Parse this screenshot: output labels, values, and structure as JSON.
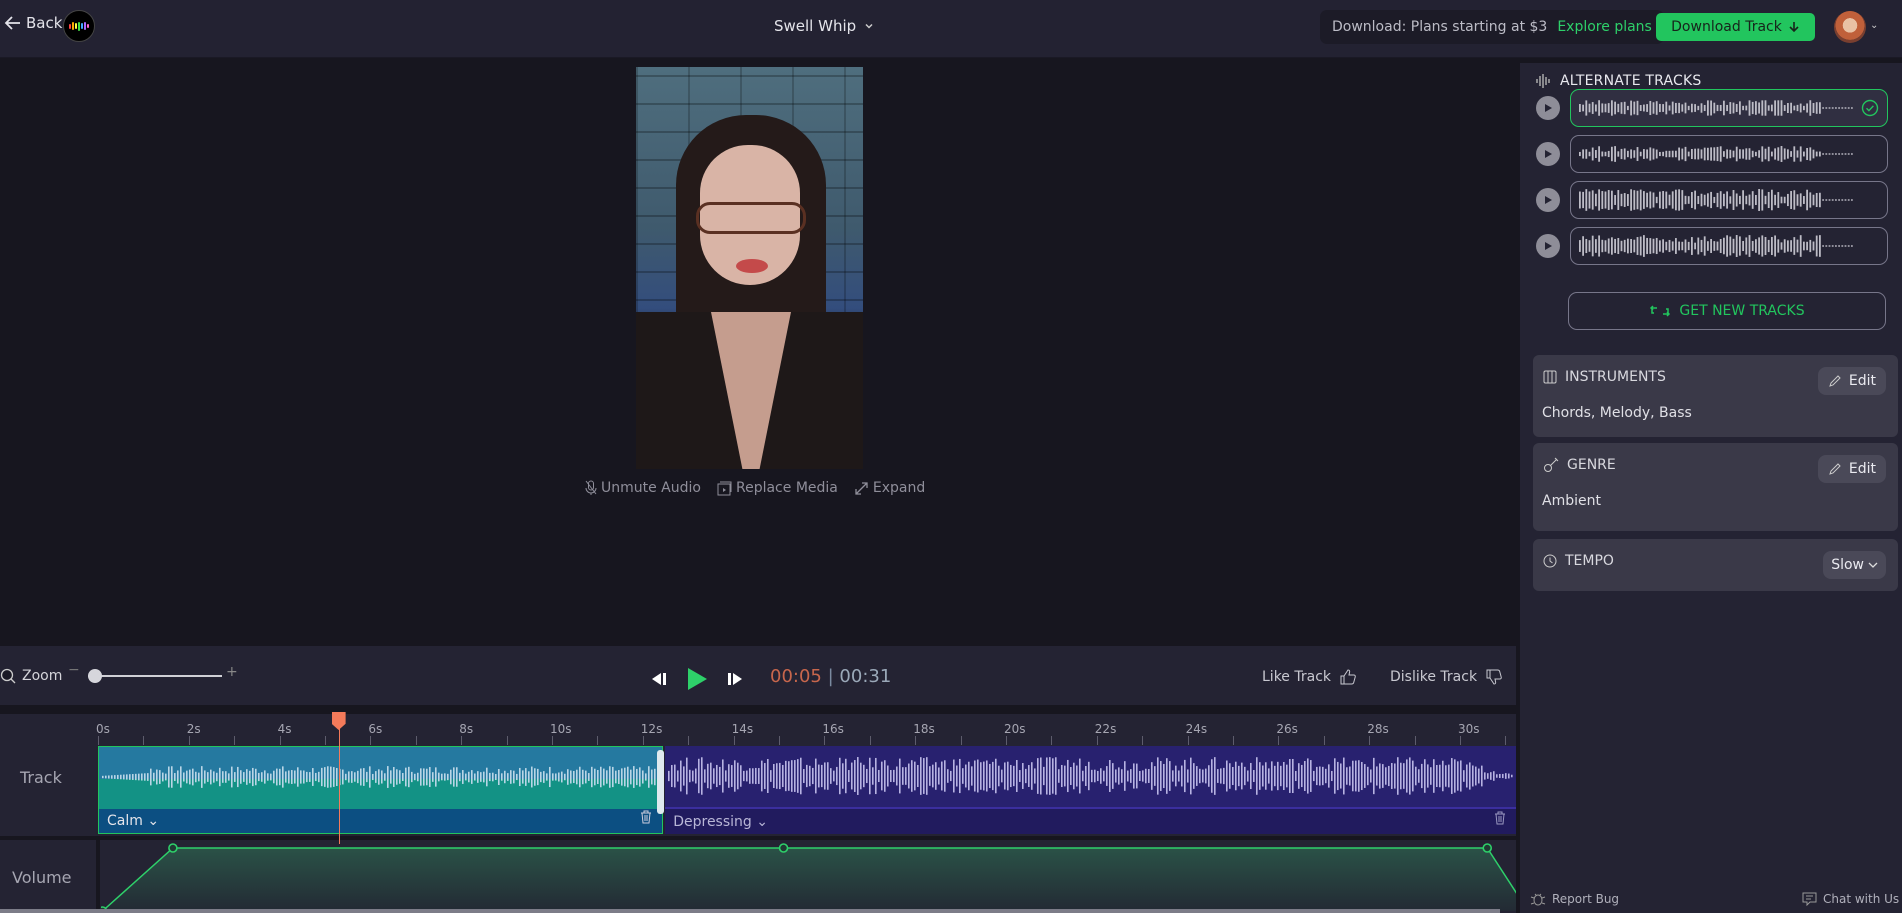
{
  "topbar": {
    "back_label": "Back",
    "project_title": "Swell Whip",
    "promo_text": "Download: Plans starting at $3",
    "promo_link": "Explore plans",
    "download_label": "Download Track"
  },
  "video": {
    "actions": [
      {
        "label": "Unmute Audio",
        "icon": "mic-muted-icon"
      },
      {
        "label": "Replace Media",
        "icon": "replace-media-icon"
      },
      {
        "label": "Expand",
        "icon": "expand-icon"
      }
    ]
  },
  "controls": {
    "zoom_label": "Zoom",
    "zoom_minus": "−",
    "zoom_plus": "+",
    "zoom_level": 0.05,
    "current_time": "00:05",
    "separator": "|",
    "total_time": "00:31",
    "like_label": "Like Track",
    "dislike_label": "Dislike Track"
  },
  "timeline": {
    "track_label": "Track",
    "volume_label": "Volume",
    "duration_s": 31.5,
    "playhead_s": 5.3,
    "ticks": [
      "0s",
      "2s",
      "4s",
      "6s",
      "8s",
      "10s",
      "12s",
      "14s",
      "16s",
      "18s",
      "20s",
      "22s",
      "24s",
      "26s",
      "28s",
      "30s"
    ],
    "segments": [
      {
        "name": "Calm",
        "start_s": 0,
        "end_s": 12.45,
        "selected": true
      },
      {
        "name": "Depressing",
        "start_s": 12.45,
        "end_s": 31.5,
        "selected": false
      }
    ],
    "volume_points": [
      {
        "t_s": 0.1,
        "level": 0.0
      },
      {
        "t_s": 1.65,
        "level": 1.0
      },
      {
        "t_s": 15.1,
        "level": 1.0
      },
      {
        "t_s": 30.6,
        "level": 1.0
      },
      {
        "t_s": 31.5,
        "level": 0.0
      }
    ]
  },
  "sidebar": {
    "alternate_title": "ALTERNATE TRACKS",
    "alternates": [
      {
        "selected": true
      },
      {
        "selected": false
      },
      {
        "selected": false
      },
      {
        "selected": false
      }
    ],
    "get_new_label": "GET NEW TRACKS",
    "instruments": {
      "title": "INSTRUMENTS",
      "edit_label": "Edit",
      "value": "Chords, Melody, Bass"
    },
    "genre": {
      "title": "GENRE",
      "edit_label": "Edit",
      "value": "Ambient"
    },
    "tempo": {
      "title": "TEMPO",
      "value": "Slow"
    },
    "report_bug": "Report Bug",
    "chat": "Chat with Us"
  },
  "colors": {
    "accent_green": "#22c55e",
    "playhead": "#f47a5a",
    "calm_segment": "#2579a0",
    "depressing_segment": "#28216f"
  }
}
